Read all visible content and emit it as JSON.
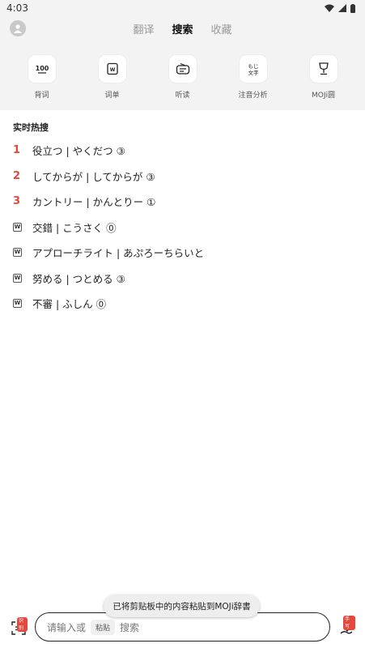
{
  "status": {
    "time": "4:03"
  },
  "header": {
    "tabs": [
      {
        "label": "翻译",
        "active": false
      },
      {
        "label": "搜索",
        "active": true
      },
      {
        "label": "收藏",
        "active": false
      }
    ]
  },
  "tools": [
    {
      "label": "背词",
      "icon": "100-icon"
    },
    {
      "label": "词单",
      "icon": "word-list-icon"
    },
    {
      "label": "听读",
      "icon": "radio-icon"
    },
    {
      "label": "注音分析",
      "icon": "furigana-icon"
    },
    {
      "label": "MOJi圆",
      "icon": "trophy-icon"
    }
  ],
  "hot": {
    "title": "实时热搜",
    "items": [
      {
        "rank": "1",
        "text": "役立つ | やくだつ ③"
      },
      {
        "rank": "2",
        "text": "してからが | してからが ③"
      },
      {
        "rank": "3",
        "text": "カントリー | かんとりー ①"
      },
      {
        "rank": "W",
        "text": "交錯 | こうさく ⓪"
      },
      {
        "rank": "W",
        "text": "アプローチライト | あぷろーちらいと"
      },
      {
        "rank": "W",
        "text": "努める | つとめる ③"
      },
      {
        "rank": "W",
        "text": "不審 | ふしん ⓪"
      }
    ]
  },
  "toast": "已将剪贴板中的内容粘贴到MOJi辞書",
  "bottom": {
    "scan_badge": "识别",
    "placeholder_before": "请输入或",
    "paste_label": "粘贴",
    "placeholder_after": "搜索",
    "handwrite_badge": "手写"
  },
  "colors": {
    "accent": "#e4473b",
    "background_top": "#f3f3f3"
  }
}
